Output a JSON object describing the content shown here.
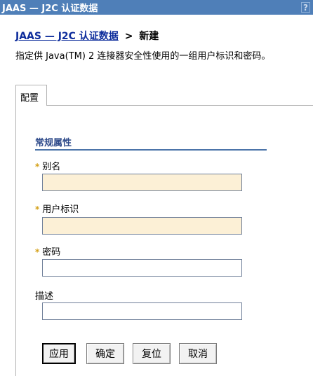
{
  "window": {
    "title": "JAAS — J2C 认证数据",
    "help_icon": "?"
  },
  "breadcrumb": {
    "link": "JAAS — J2C 认证数据",
    "separator": ">",
    "current": "新建"
  },
  "description": "指定供 Java(TM) 2 连接器安全性使用的一组用户标识和密码。",
  "tabs": [
    {
      "label": "配置",
      "selected": true
    }
  ],
  "form": {
    "section_title": "常规属性",
    "required_marker": "*",
    "fields": [
      {
        "label": "别名",
        "required": true,
        "value": ""
      },
      {
        "label": "用户标识",
        "required": true,
        "value": ""
      },
      {
        "label": "密码",
        "required": true,
        "value": ""
      },
      {
        "label": "描述",
        "required": false,
        "value": ""
      }
    ]
  },
  "buttons": {
    "apply": "应用",
    "ok": "确定",
    "reset": "复位",
    "cancel": "取消"
  },
  "colors": {
    "title_bar": "#4f7fb8",
    "link": "#0e2d9c",
    "required_field_bg": "#fcf0d6",
    "section_rule": "#4c74a9"
  }
}
